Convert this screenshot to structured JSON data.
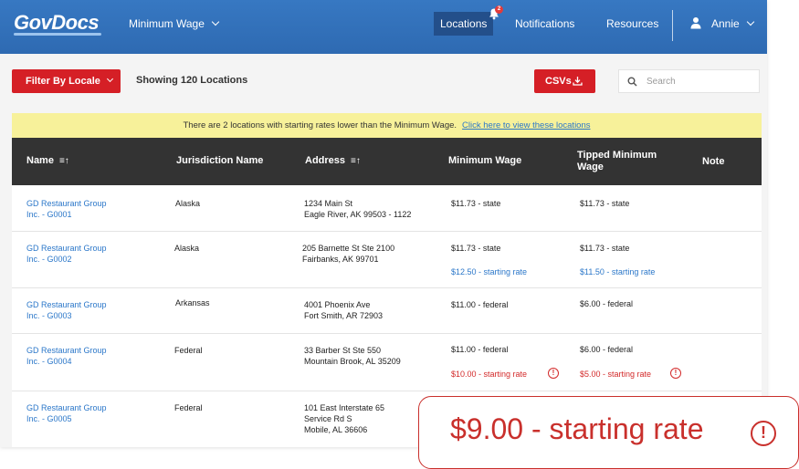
{
  "nav": {
    "logo": "GovDocs",
    "product_menu": "Minimum Wage",
    "locations": "Locations",
    "notification_count": "2",
    "notifications": "Notifications",
    "resources": "Resources",
    "user_name": "Annie"
  },
  "toolbar": {
    "filter_label": "Filter By Locale",
    "showing_text": "Showing 120 Locations",
    "csv_label": "CSVs",
    "search_placeholder": "Search"
  },
  "alert": {
    "message": "There are 2 locations with starting rates lower than the Minimum Wage.",
    "link_text": "Click here to view these locations"
  },
  "table": {
    "headers": {
      "name": "Name",
      "jurisdiction": "Jurisdiction Name",
      "address": "Address",
      "minimum_wage": "Minimum Wage",
      "tipped_line1": "Tipped Minimum",
      "tipped_line2": "Wage",
      "note": "Note"
    },
    "rows": [
      {
        "name_line1": "GD Restaurant Group",
        "name_line2": "Inc. - G0001",
        "jurisdiction": "Alaska",
        "address_line1": "1234 Main St",
        "address_line2": "Eagle River, AK 99503 - 1122",
        "address_line3": "",
        "min_wage": "$11.73 - state",
        "min_starting": "",
        "tipped": "$11.73 - state",
        "tipped_starting": ""
      },
      {
        "name_line1": "GD Restaurant Group",
        "name_line2": "Inc. - G0002",
        "jurisdiction": "Alaska",
        "address_line1": "205 Barnette St Ste 2100",
        "address_line2": "Fairbanks, AK 99701",
        "address_line3": "",
        "min_wage": "$11.73 - state",
        "min_starting": "$12.50 - starting rate",
        "tipped": "$11.73 - state",
        "tipped_starting": "$11.50 - starting rate"
      },
      {
        "name_line1": "GD Restaurant Group",
        "name_line2": "Inc. - G0003",
        "jurisdiction": "Arkansas",
        "address_line1": "4001 Phoenix Ave",
        "address_line2": "Fort Smith, AR 72903",
        "address_line3": "",
        "min_wage": "$11.00 - federal",
        "min_starting": "",
        "tipped": "$6.00 - federal",
        "tipped_starting": ""
      },
      {
        "name_line1": "GD Restaurant Group",
        "name_line2": "Inc. - G0004",
        "jurisdiction": "Federal",
        "address_line1": "33 Barber St Ste 550",
        "address_line2": "Mountain Brook, AL 35209",
        "address_line3": "",
        "min_wage": "$11.00 - federal",
        "min_starting": "$10.00 - starting rate",
        "tipped": "$6.00 - federal",
        "tipped_starting": "$5.00 - starting rate"
      },
      {
        "name_line1": "GD Restaurant Group",
        "name_line2": "Inc. - G0005",
        "jurisdiction": "Federal",
        "address_line1": "101 East Interstate 65",
        "address_line2": "Service Rd S",
        "address_line3": "Mobile, AL 36606",
        "min_wage": "",
        "min_starting": "",
        "tipped": "",
        "tipped_starting": ""
      }
    ]
  },
  "callout": {
    "text": "$9.00 - starting rate"
  },
  "colors": {
    "nav_blue": "#3778c2",
    "brand_red": "#d51f26",
    "link_blue": "#2b77c9",
    "alert_yellow": "#f7f19a",
    "header_dark": "#333333",
    "warning_red": "#d32a2a"
  }
}
